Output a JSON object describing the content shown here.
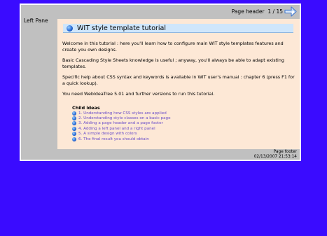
{
  "colors": {
    "background": "#3a0bff",
    "frame": "#c0c0c0",
    "panel": "#fde8d6",
    "title_bar": "#cfe6fb",
    "link": "#6b4fc9"
  },
  "header": {
    "label": "Page header",
    "page_indicator": "1 / 15",
    "next_icon": "arrow-right-icon"
  },
  "left_pane": {
    "label": "Left Pane"
  },
  "main": {
    "title": "WIT style template tutorial",
    "paragraphs": [
      "Welcome in this tutorial : here you'll learn how to configure main WIT style templates features and create you own designs.",
      "Basic Cascading Style Sheets knowledge is useful ; anyway, you'll always be able to adapt existing templates.",
      "Specific help about CSS syntax and keywords is available in WIT user's manual : chapter 6 (press F1 for a quick lookup).",
      "You need WebIdeaTree 5.01 and further versions to run this tutorial."
    ],
    "child_ideas_title": "Child ideas",
    "child_ideas": [
      "1. Understanding how CSS styles are applied",
      "2. Understanding style classes on a basic page",
      "3. Adding a page header and a page footer",
      "4. Adding a left panel and a right panel",
      "5. A simple design with colors",
      "6. The final result you should obtain"
    ]
  },
  "footer": {
    "label": "Page footer",
    "timestamp": "02/13/2007 21:53:14"
  }
}
